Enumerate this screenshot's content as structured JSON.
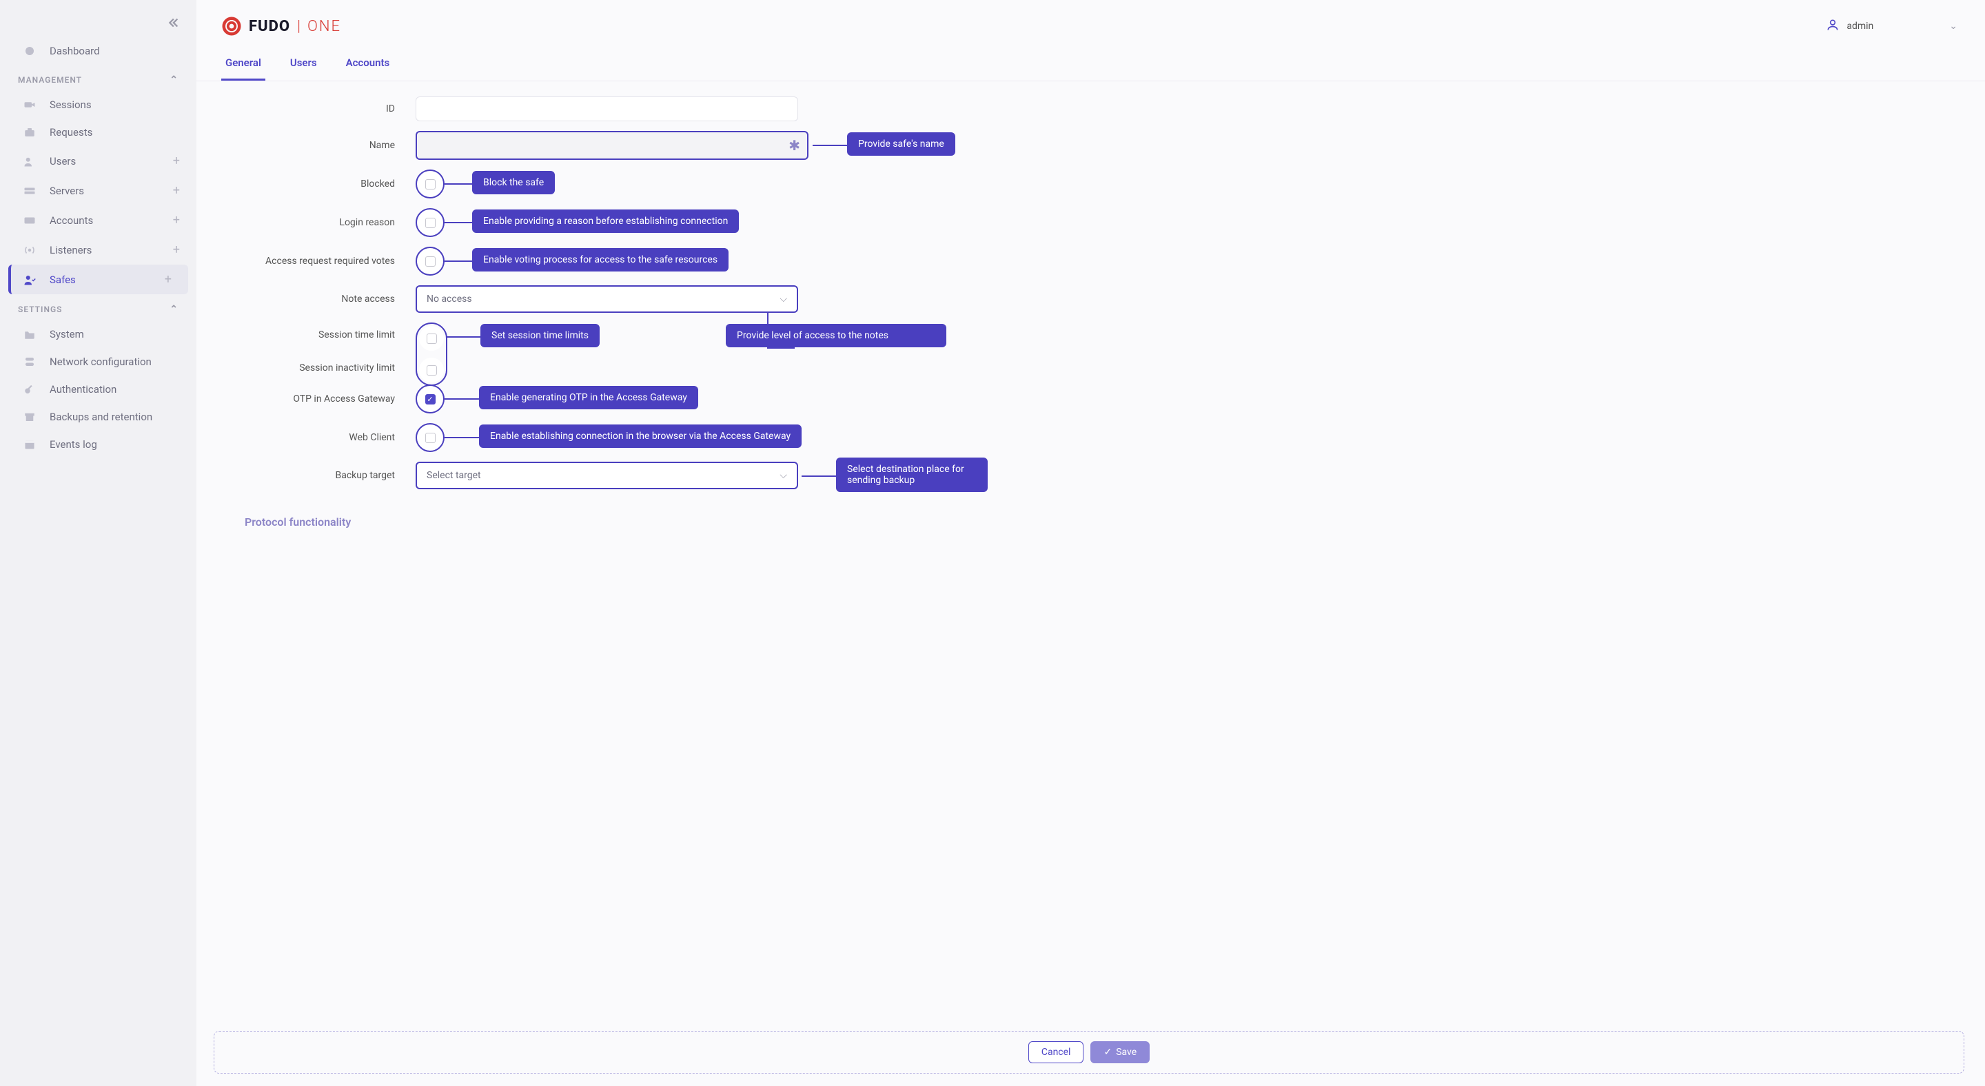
{
  "brand": {
    "name1": "FUDO",
    "name2": "ONE"
  },
  "user": {
    "name": "admin"
  },
  "sidebar": {
    "dashboard": "Dashboard",
    "section_management": "MANAGEMENT",
    "sessions": "Sessions",
    "requests": "Requests",
    "users": "Users",
    "servers": "Servers",
    "accounts": "Accounts",
    "listeners": "Listeners",
    "safes": "Safes",
    "section_settings": "SETTINGS",
    "system": "System",
    "network": "Network configuration",
    "auth": "Authentication",
    "backups": "Backups and retention",
    "events": "Events log"
  },
  "tabs": {
    "general": "General",
    "users": "Users",
    "accounts": "Accounts"
  },
  "form": {
    "id_label": "ID",
    "name_label": "Name",
    "blocked_label": "Blocked",
    "login_reason_label": "Login reason",
    "access_votes_label": "Access request required votes",
    "note_access_label": "Note access",
    "note_access_value": "No access",
    "session_limit_label": "Session time limit",
    "inactivity_limit_label": "Session inactivity limit",
    "otp_label": "OTP in Access Gateway",
    "web_client_label": "Web Client",
    "backup_target_label": "Backup target",
    "backup_target_value": "Select target"
  },
  "callouts": {
    "name": "Provide safe's name",
    "blocked": "Block the safe",
    "login_reason": "Enable providing a reason before establishing connection",
    "access_votes": "Enable voting process for access to the safe resources",
    "note_access": "Provide level of access to the notes",
    "session_limit": "Set session time limits",
    "otp": "Enable generating OTP in the Access Gateway",
    "web_client": "Enable establishing connection in the browser via the Access Gateway",
    "backup": "Select destination place for sending backup"
  },
  "protocol_section": "Protocol functionality",
  "buttons": {
    "cancel": "Cancel",
    "save": "Save"
  }
}
